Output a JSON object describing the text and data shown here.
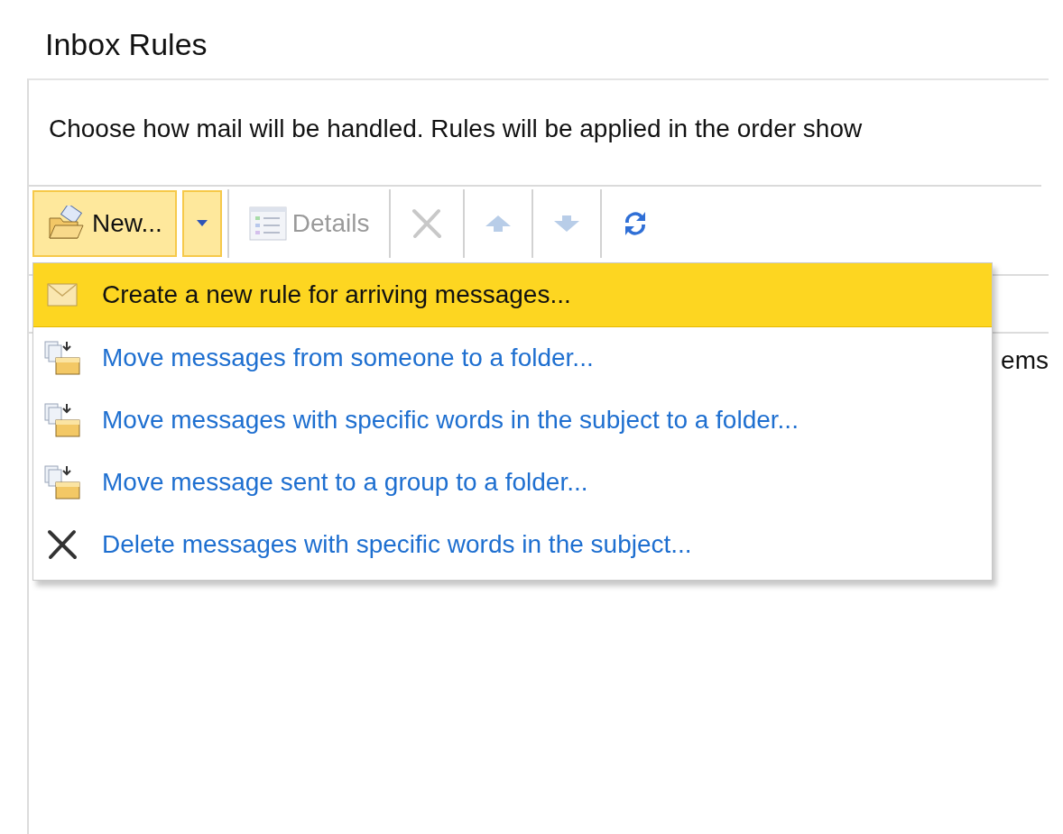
{
  "title": "Inbox Rules",
  "description": "Choose how mail will be handled. Rules will be applied in the order show",
  "toolbar": [
    {
      "kind": "new",
      "label": "New...",
      "disabled": false,
      "active": true
    },
    {
      "kind": "dropdown",
      "disabled": false,
      "active": true
    },
    {
      "kind": "details",
      "label": "Details",
      "disabled": true,
      "active": false
    },
    {
      "kind": "delete",
      "disabled": true,
      "active": false
    },
    {
      "kind": "up",
      "disabled": true,
      "active": false
    },
    {
      "kind": "down",
      "disabled": true,
      "active": false
    },
    {
      "kind": "refresh",
      "disabled": false,
      "active": false
    }
  ],
  "table": {
    "rows": [
      {
        "cells": [
          "ems"
        ]
      }
    ]
  },
  "menu": [
    {
      "kind": "envelope",
      "label": "Create a new rule for arriving messages...",
      "selected": true
    },
    {
      "kind": "move",
      "label": "Move messages from someone to a folder...",
      "selected": false
    },
    {
      "kind": "move",
      "label": "Move messages with specific words in the subject to a folder...",
      "selected": false
    },
    {
      "kind": "move",
      "label": "Move message sent to a group to a folder...",
      "selected": false
    },
    {
      "kind": "delete",
      "label": "Delete messages with specific words in the subject...",
      "selected": false
    }
  ]
}
